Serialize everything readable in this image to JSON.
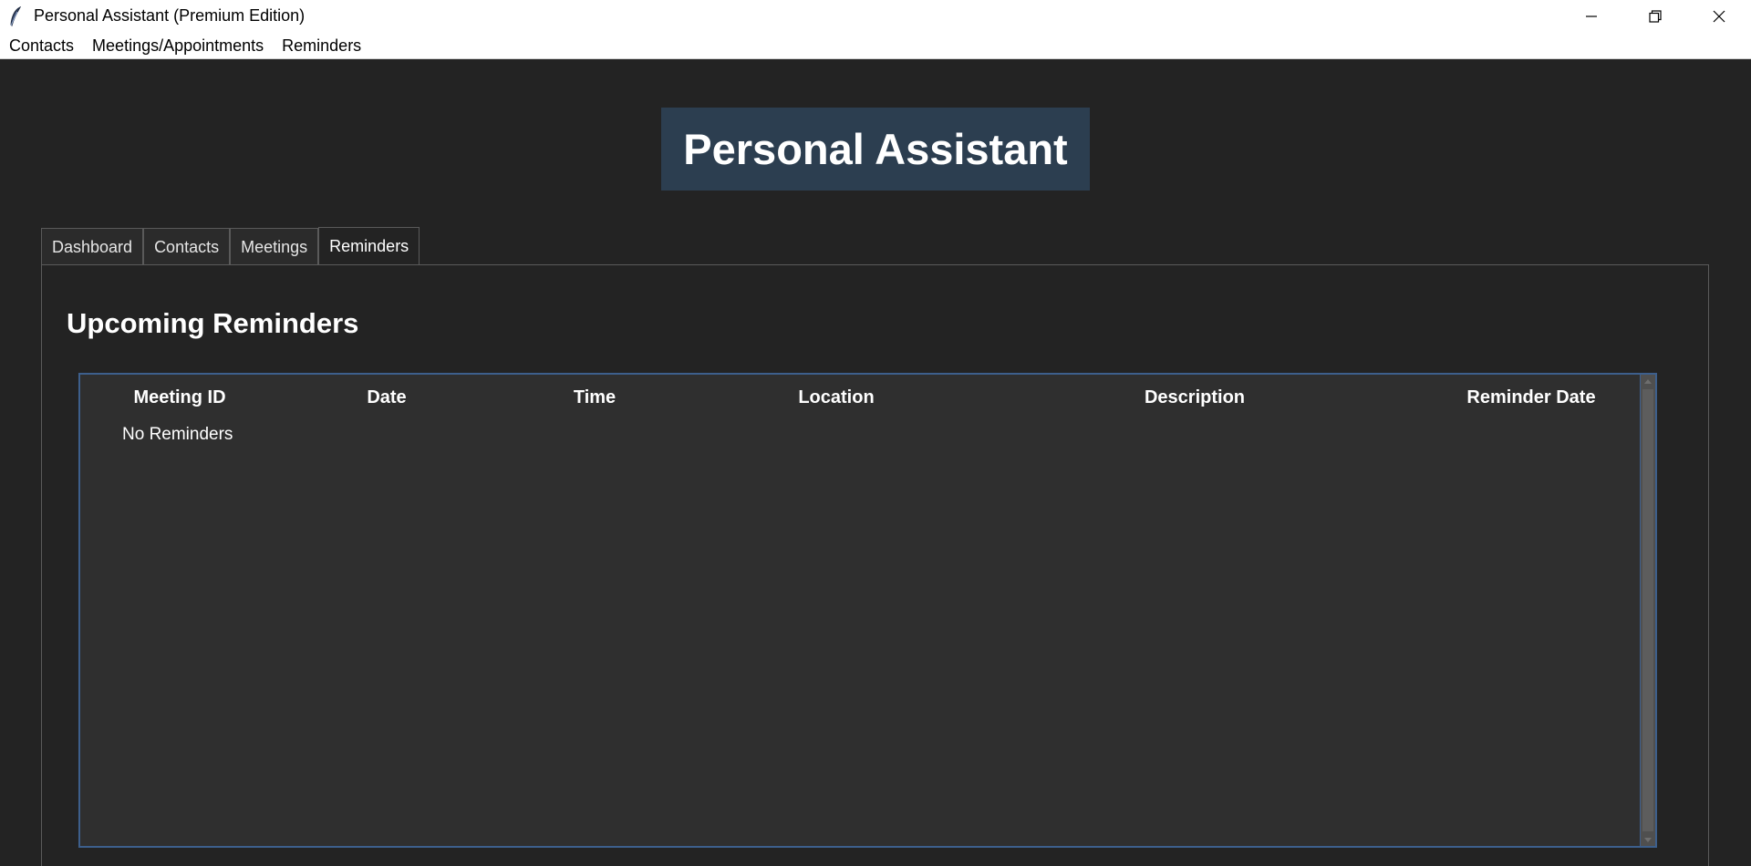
{
  "window": {
    "title": "Personal Assistant (Premium Edition)",
    "icon": "feather-icon"
  },
  "menubar": {
    "items": [
      {
        "label": "Contacts"
      },
      {
        "label": "Meetings/Appointments"
      },
      {
        "label": "Reminders"
      }
    ]
  },
  "banner": {
    "title": "Personal Assistant",
    "color": "#2c3e50"
  },
  "tabs": [
    {
      "label": "Dashboard",
      "active": false
    },
    {
      "label": "Contacts",
      "active": false
    },
    {
      "label": "Meetings",
      "active": false
    },
    {
      "label": "Reminders",
      "active": true
    }
  ],
  "reminders": {
    "heading": "Upcoming Reminders",
    "columns": [
      "Meeting ID",
      "Date",
      "Time",
      "Location",
      "Description",
      "Reminder Date"
    ],
    "empty_text": "No Reminders"
  },
  "colors": {
    "background": "#232323",
    "table_bg": "#2f2f2f",
    "table_border": "#3d5f8c"
  }
}
